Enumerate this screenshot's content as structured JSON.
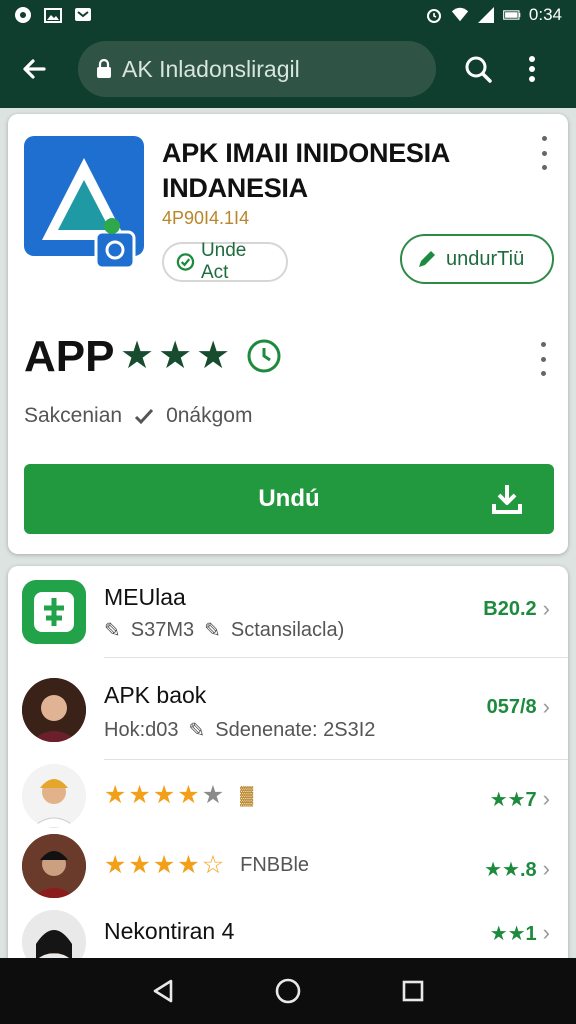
{
  "status_bar": {
    "time": "0:34"
  },
  "toolbar": {
    "url_text": "AK Inladonsliragil"
  },
  "app": {
    "title": "APK IMAII INIDONESIA INDANESIA",
    "version": "4P90I4.1I4",
    "chip_left": "Unde Act",
    "chip_right": "undurTiü",
    "label": "APP",
    "rating_stars": 3.5,
    "sub_left": "Sakcenian",
    "sub_right": "0nákgom",
    "primary_button": "Undú"
  },
  "list": [
    {
      "title": "MEUlaa",
      "sub1": "S37M3",
      "sub2": "Sctansilacla)",
      "right": "B20.2"
    },
    {
      "title": "APK baok",
      "sub1": "Hok:d03",
      "sub2": "Sdenenate: 2S3I2",
      "right": "057/8"
    },
    {
      "rating": 4,
      "badge": "▓",
      "right": "★★7"
    },
    {
      "rating": 4.5,
      "sub": "FNBBle",
      "right": "★★.8"
    },
    {
      "title": "Nekontiran 4",
      "right": "★★1"
    }
  ],
  "colors": {
    "brand_green": "#23993f",
    "header_dark": "#0f3d2e",
    "star_dark": "#174d2e",
    "star_orange": "#f2a019"
  }
}
